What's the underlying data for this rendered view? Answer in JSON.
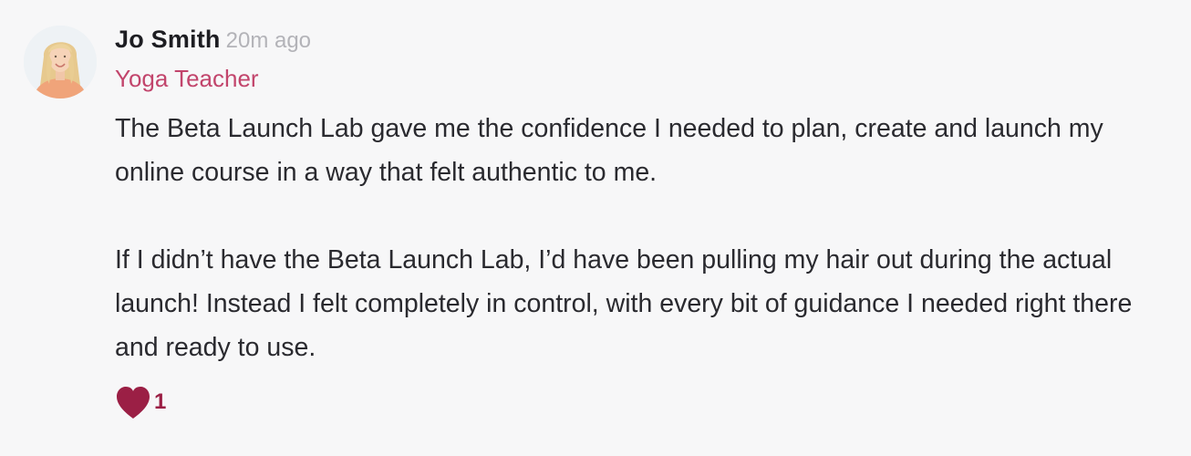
{
  "comment": {
    "author": "Jo Smith",
    "time_ago": "20m ago",
    "role": "Yoga Teacher",
    "paragraphs": [
      "The Beta Launch Lab gave me the confidence I needed to plan, create and launch my online course in a way that felt authentic to me.",
      "If I didn’t have the Beta Launch Lab, I’d have been pulling my hair out during the actual launch! Instead I felt completely in control, with every bit of guidance I needed right there and ready to use."
    ],
    "likes": {
      "icon": "heart-icon",
      "count": "1"
    }
  },
  "colors": {
    "role": "#c2456c",
    "heart": "#9b1f45",
    "time": "#b3b3b8"
  }
}
